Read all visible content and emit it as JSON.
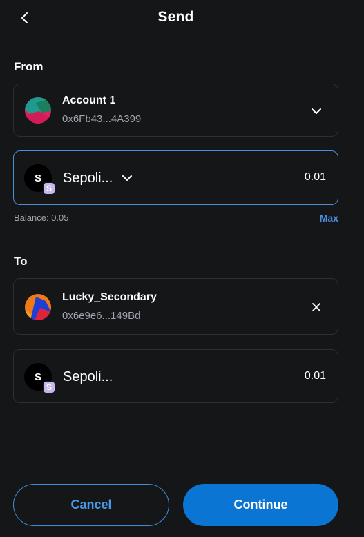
{
  "header": {
    "title": "Send",
    "back_icon": "chevron-left-icon"
  },
  "from": {
    "label": "From",
    "account": {
      "name": "Account 1",
      "address": "0x6Fb43...4A399",
      "chevron_icon": "chevron-down-icon"
    },
    "asset": {
      "symbol_letter": "S",
      "badge_letter": "S",
      "name": "Sepoli...",
      "amount": "0.01",
      "chevron_icon": "chevron-down-icon"
    },
    "balance": "Balance: 0.05",
    "max_label": "Max"
  },
  "to": {
    "label": "To",
    "account": {
      "name": "Lucky_Secondary",
      "address": "0x6e9e6...149Bd",
      "clear_icon": "close-icon"
    },
    "asset": {
      "symbol_letter": "S",
      "badge_letter": "S",
      "name": "Sepoli...",
      "amount": "0.01"
    }
  },
  "actions": {
    "cancel_label": "Cancel",
    "continue_label": "Continue"
  },
  "colors": {
    "background": "#141618",
    "accent": "#0a75d3",
    "link": "#4a90e2",
    "focus_border": "#4a90d9",
    "muted_text": "#9fa6ae",
    "token_badge": "#c6b6ee"
  }
}
